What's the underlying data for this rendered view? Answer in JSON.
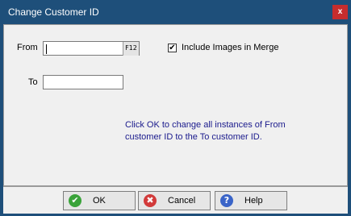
{
  "window": {
    "title": "Change Customer ID",
    "close_glyph": "x"
  },
  "form": {
    "from_label": "From",
    "from_value": "",
    "f12_label": "F12",
    "to_label": "To",
    "to_value": "",
    "include_images_label": "Include Images in Merge",
    "include_images_checked": true,
    "check_glyph": "✔",
    "message": "Click OK to change all instances of From customer ID to the To customer ID."
  },
  "buttons": {
    "ok": {
      "label": "OK",
      "icon": "check-icon",
      "glyph": "✔",
      "color": "#3aa33a"
    },
    "cancel": {
      "label": "Cancel",
      "icon": "cancel-icon",
      "glyph": "✖",
      "color": "#d23a3a"
    },
    "help": {
      "label": "Help",
      "icon": "help-icon",
      "glyph": "?",
      "color": "#3a64c8"
    }
  },
  "colors": {
    "title_bar": "#1e4f7a",
    "message_text": "#1a1a8c"
  }
}
